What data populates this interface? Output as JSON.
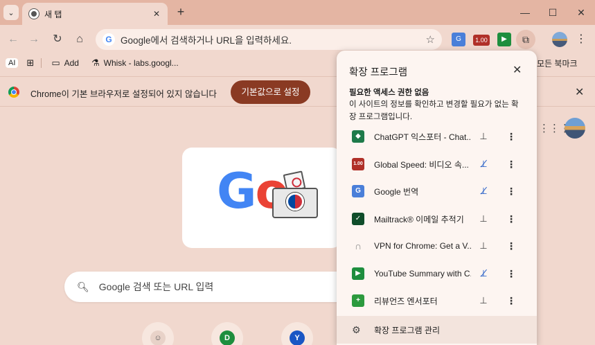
{
  "tabbar": {
    "tab_title": "새 탭",
    "tab_close": "✕",
    "new_tab": "+",
    "minimize": "—",
    "maximize": "☐",
    "close": "✕",
    "tab_search": "⌄"
  },
  "toolbar": {
    "back": "←",
    "forward": "→",
    "reload": "↻",
    "home": "⌂",
    "omnibox_placeholder": "Google에서 검색하거나 URL을 입력하세요.",
    "star": "☆",
    "speed_badge": "1.00",
    "menu": "⋮"
  },
  "bookmarks": {
    "ai_label": "AI",
    "apps": "⊞",
    "items": [
      {
        "label": "Add",
        "icon": "folder-icon"
      },
      {
        "label": "Whisk - labs.googl...",
        "icon": "flask-icon"
      }
    ],
    "all_bookmarks": "모든 북마크"
  },
  "infobar": {
    "message": "Chrome이 기본 브라우저로 설정되어 있지 않습니다",
    "button": "기본값으로 설정",
    "close": "✕"
  },
  "ntp": {
    "search_placeholder": "Google 검색 또는 URL 입력",
    "doodle_word": "Google",
    "shortcuts": [
      {
        "letter": "",
        "color": "#e8d2c8"
      },
      {
        "letter": "D",
        "color": "#1e8e3e"
      },
      {
        "letter": "Y",
        "color": "#1a56c4"
      }
    ]
  },
  "popup": {
    "title": "확장 프로그램",
    "close": "✕",
    "section_heading": "필요한 액세스 권한 없음",
    "section_desc": "이 사이트의 정보를 확인하고 변경할 필요가 없는 확장 프로그램입니다.",
    "extensions": [
      {
        "name": "ChatGPT 익스포터 - Chat...",
        "icon_color": "#1e7a4a",
        "icon_text": "◆",
        "pinned": true
      },
      {
        "name": "Global Speed: 비디오 속...",
        "icon_color": "#b03028",
        "icon_text": "1.00",
        "pinned": false
      },
      {
        "name": "Google 번역",
        "icon_color": "#4a7fd9",
        "icon_text": "G",
        "pinned": false
      },
      {
        "name": "Mailtrack® 이메일 추적기",
        "icon_color": "#0f4d2a",
        "icon_text": "✓",
        "pinned": true
      },
      {
        "name": "VPN for Chrome: Get a V...",
        "icon_color": "#9a9a9a",
        "icon_text": "∩",
        "pinned": true
      },
      {
        "name": "YouTube Summary with C...",
        "icon_color": "#1e8e3e",
        "icon_text": "▶",
        "pinned": false
      },
      {
        "name": "리뷰언즈 엔서포터",
        "icon_color": "#2c9a3e",
        "icon_text": "+",
        "pinned": true
      }
    ],
    "manage": "확장 프로그램 관리"
  }
}
